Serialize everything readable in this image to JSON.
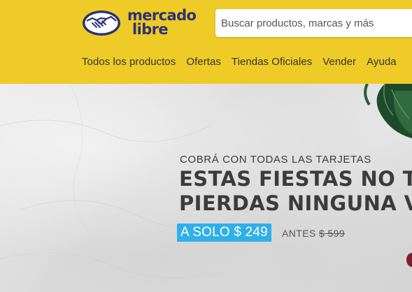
{
  "header": {
    "background_color": "#eecb27",
    "logo": {
      "line1": "mercado",
      "line2": "libre",
      "icon": "handshake-icon"
    },
    "search": {
      "placeholder": "Buscar productos, marcas y más",
      "value": ""
    },
    "nav": [
      {
        "label": "Todos los productos"
      },
      {
        "label": "Ofertas"
      },
      {
        "label": "Tiendas Oficiales"
      },
      {
        "label": "Vender"
      },
      {
        "label": "Ayuda"
      }
    ]
  },
  "banner": {
    "kicker": "COBRÁ CON TODAS LAS TARJETAS",
    "headline_line1": "ESTAS FIESTAS NO T",
    "headline_line2": "PIERDAS NINGUNA V",
    "price_label": "A SOLO $ 249",
    "before_label": "ANTES",
    "before_price": "$ 599",
    "price_color": "#2fb0e8"
  }
}
